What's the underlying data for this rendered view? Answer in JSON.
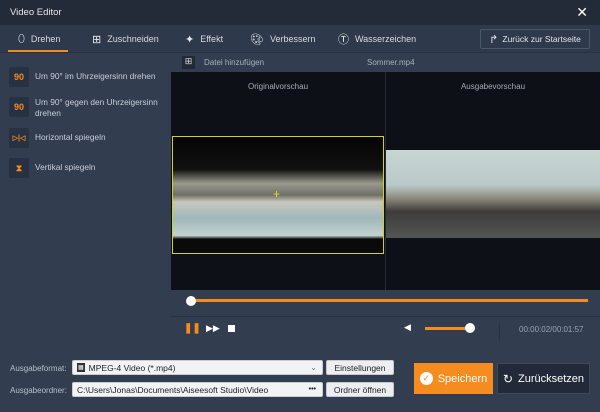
{
  "window": {
    "title": "Video Editor"
  },
  "tabs": [
    {
      "label": "Drehen",
      "icon": "rotate-icon"
    },
    {
      "label": "Zuschneiden",
      "icon": "crop-icon"
    },
    {
      "label": "Effekt",
      "icon": "sparkle-icon"
    },
    {
      "label": "Verbessern",
      "icon": "palette-icon"
    },
    {
      "label": "Wasserzeichen",
      "icon": "watermark-icon"
    }
  ],
  "back_button": "Zurück zur Startseite",
  "operations": [
    {
      "label": "Um 90° im Uhrzeigersinn drehen",
      "icon": "90"
    },
    {
      "label": "Um 90° gegen den Uhrzeigersinn drehen",
      "icon": "90"
    },
    {
      "label": "Horizontal spiegeln",
      "icon": "▷|◁"
    },
    {
      "label": "Vertikal spiegeln",
      "icon": "⧗"
    }
  ],
  "preview": {
    "add_file": "Datei hinzufügen",
    "filename": "Sommer.mp4",
    "original_label": "Originalvorschau",
    "output_label": "Ausgabevorschau"
  },
  "player": {
    "progress": 0.01,
    "volume": 0.75,
    "time": "00:00:02/00:01:57"
  },
  "output": {
    "format_label": "Ausgabeformat:",
    "format_value": "MPEG-4 Video (*.mp4)",
    "settings_button": "Einstellungen",
    "folder_label": "Ausgabeordner:",
    "folder_value": "C:\\Users\\Jonas\\Documents\\Aiseesoft Studio\\Video",
    "browse": "•••",
    "open_folder_button": "Ordner öffnen"
  },
  "actions": {
    "save": "Speichern",
    "reset": "Zurücksetzen"
  },
  "colors": {
    "accent": "#f68b1f"
  }
}
